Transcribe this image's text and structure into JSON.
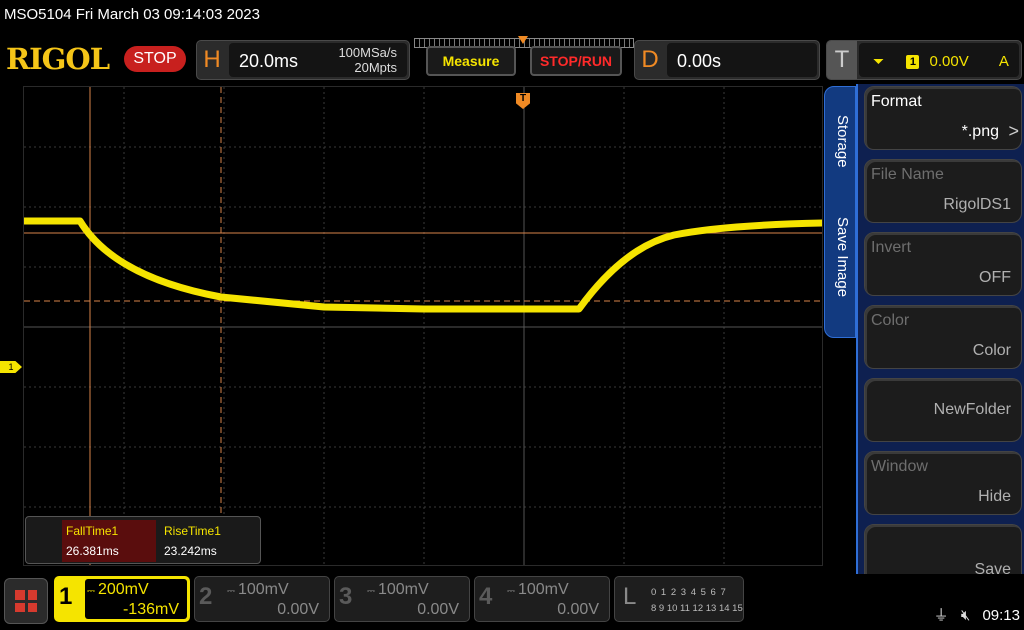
{
  "title": "MSO5104  Fri March 03 09:14:03 2023",
  "brand": "RIGOL",
  "run_state": "STOP",
  "horizontal": {
    "letter": "H",
    "scale": "20.0ms",
    "sample_rate": "100MSa/s",
    "memory_depth": "20Mpts"
  },
  "buttons": {
    "measure": "Measure",
    "stop_run": "STOP/RUN"
  },
  "delay": {
    "letter": "D",
    "value": "0.00s"
  },
  "trigger": {
    "letter": "T",
    "source": "1",
    "level": "0.00V",
    "mode": "A",
    "edge_icon": "falling-edge-icon"
  },
  "screen": {
    "ch1_marker": "1",
    "trigger_marker": "T"
  },
  "measurements": [
    {
      "label": "FallTime1",
      "value": "26.381ms"
    },
    {
      "label": "RiseTime1",
      "value": "23.242ms"
    }
  ],
  "side_tabs": [
    "Storage",
    "Save Image"
  ],
  "menu": [
    {
      "title": "Format",
      "value": "*.png",
      "enabled": true,
      "chevron": ">"
    },
    {
      "title": "File Name",
      "value": "RigolDS1",
      "enabled": false
    },
    {
      "title": "Invert",
      "value": "OFF",
      "enabled": false
    },
    {
      "title": "Color",
      "value": "Color",
      "enabled": false
    },
    {
      "title": "",
      "value": "NewFolder",
      "enabled": false
    },
    {
      "title": "Window",
      "value": "Hide",
      "enabled": false
    },
    {
      "title": "",
      "value": "Save",
      "enabled": false
    }
  ],
  "channels": [
    {
      "num": "1",
      "scale": "200mV",
      "offset": "-136mV",
      "active": true
    },
    {
      "num": "2",
      "scale": "100mV",
      "offset": "0.00V",
      "active": false
    },
    {
      "num": "3",
      "scale": "100mV",
      "offset": "0.00V",
      "active": false
    },
    {
      "num": "4",
      "scale": "100mV",
      "offset": "0.00V",
      "active": false
    }
  ],
  "logic": {
    "letter": "L",
    "row1": "0 1 2 3  4 5 6 7",
    "row2": "8 9 10 11 12 13 14 15"
  },
  "status": {
    "usb_icon": "usb-icon",
    "sound_icon": "speaker-muted-icon",
    "time": "09:13"
  },
  "colors": {
    "ch1": "#f5e400",
    "brand": "#f5c518",
    "stop": "#c8201e",
    "trigger": "#f08a24",
    "menu_accent": "#2f6ed6"
  }
}
